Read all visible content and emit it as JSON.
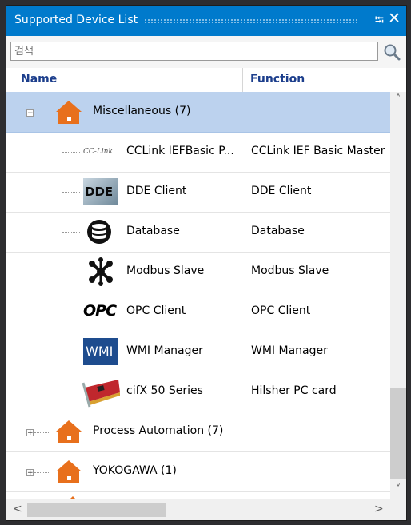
{
  "panel": {
    "title": "Supported Device List",
    "pin_icon": "pin-icon",
    "close_icon": "close-icon"
  },
  "search": {
    "placeholder": "검색",
    "icon": "magnifier-icon"
  },
  "columns": {
    "name": "Name",
    "function": "Function"
  },
  "groups": {
    "misc": {
      "label": "Miscellaneous (7)",
      "expanded": true,
      "selected": true
    },
    "process": {
      "label": "Process Automation (7)",
      "expanded": false
    },
    "yokogawa": {
      "label": "YOKOGAWA (1)",
      "expanded": false
    }
  },
  "items": [
    {
      "name": "CCLink IEFBasic P...",
      "function": "CCLink IEF Basic Master",
      "icon": "cclink-logo-icon",
      "logo_text": "CC-Link"
    },
    {
      "name": "DDE Client",
      "function": "DDE Client",
      "icon": "dde-icon",
      "logo_text": "DDE"
    },
    {
      "name": "Database",
      "function": "Database",
      "icon": "database-icon"
    },
    {
      "name": "Modbus Slave",
      "function": "Modbus Slave",
      "icon": "modbus-icon"
    },
    {
      "name": "OPC Client",
      "function": "OPC Client",
      "icon": "opc-logo-icon",
      "logo_text": "OPC"
    },
    {
      "name": "WMI Manager",
      "function": "WMI Manager",
      "icon": "wmi-icon",
      "logo_text": "WMI"
    },
    {
      "name": "cifX 50 Series",
      "function": "Hilsher PC card",
      "icon": "pc-card-icon"
    }
  ],
  "colors": {
    "title_bar": "#007acc",
    "selection": "#bcd2ee",
    "header_text": "#1c3e8c",
    "folder_orange": "#e8701c"
  }
}
